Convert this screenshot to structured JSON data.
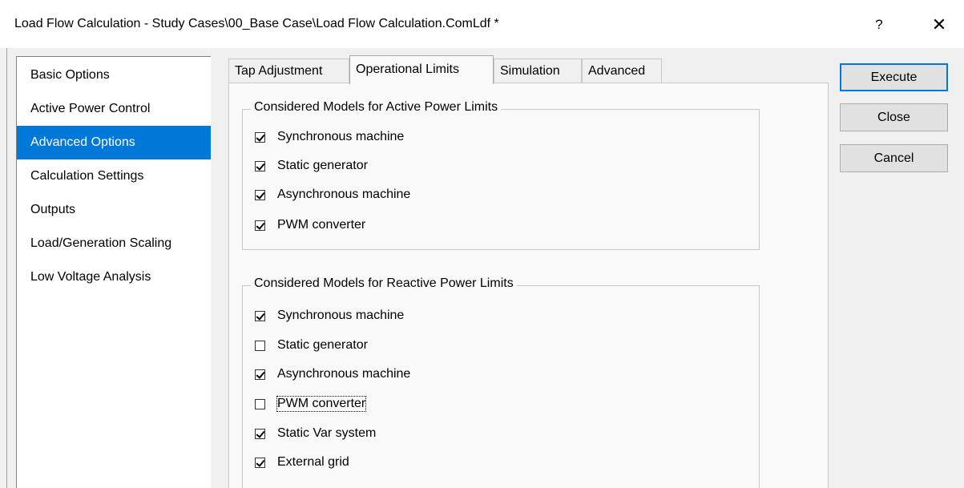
{
  "window": {
    "title": "Load Flow Calculation - Study Cases\\00_Base Case\\Load Flow Calculation.ComLdf *",
    "help_label": "?",
    "close_label": "✕"
  },
  "sidebar": {
    "items": [
      {
        "label": "Basic Options"
      },
      {
        "label": "Active Power Control"
      },
      {
        "label": "Advanced Options",
        "selected": true
      },
      {
        "label": "Calculation Settings"
      },
      {
        "label": "Outputs"
      },
      {
        "label": "Load/Generation Scaling"
      },
      {
        "label": "Low Voltage Analysis"
      }
    ]
  },
  "tabs": [
    {
      "label": "Tap Adjustment"
    },
    {
      "label": "Operational Limits",
      "active": true
    },
    {
      "label": "Simulation"
    },
    {
      "label": "Advanced"
    }
  ],
  "active_limits": {
    "title": "Considered Models for Active Power Limits",
    "items": [
      {
        "label": "Synchronous machine",
        "checked": true
      },
      {
        "label": "Static generator",
        "checked": true
      },
      {
        "label": "Asynchronous machine",
        "checked": true
      },
      {
        "label": "PWM converter",
        "checked": true
      }
    ]
  },
  "reactive_limits": {
    "title": "Considered Models for Reactive Power Limits",
    "items": [
      {
        "label": "Synchronous machine",
        "checked": true
      },
      {
        "label": "Static generator",
        "checked": false
      },
      {
        "label": "Asynchronous machine",
        "checked": true
      },
      {
        "label": "PWM converter",
        "checked": false
      },
      {
        "label": "Static Var system",
        "checked": true
      },
      {
        "label": "External grid",
        "checked": true
      }
    ]
  },
  "buttons": {
    "execute": "Execute",
    "close": "Close",
    "cancel": "Cancel"
  },
  "colors": {
    "accent": "#0078d7",
    "dialog_bg": "#f0f0f0",
    "pane_bg": "#f9f9f9"
  }
}
